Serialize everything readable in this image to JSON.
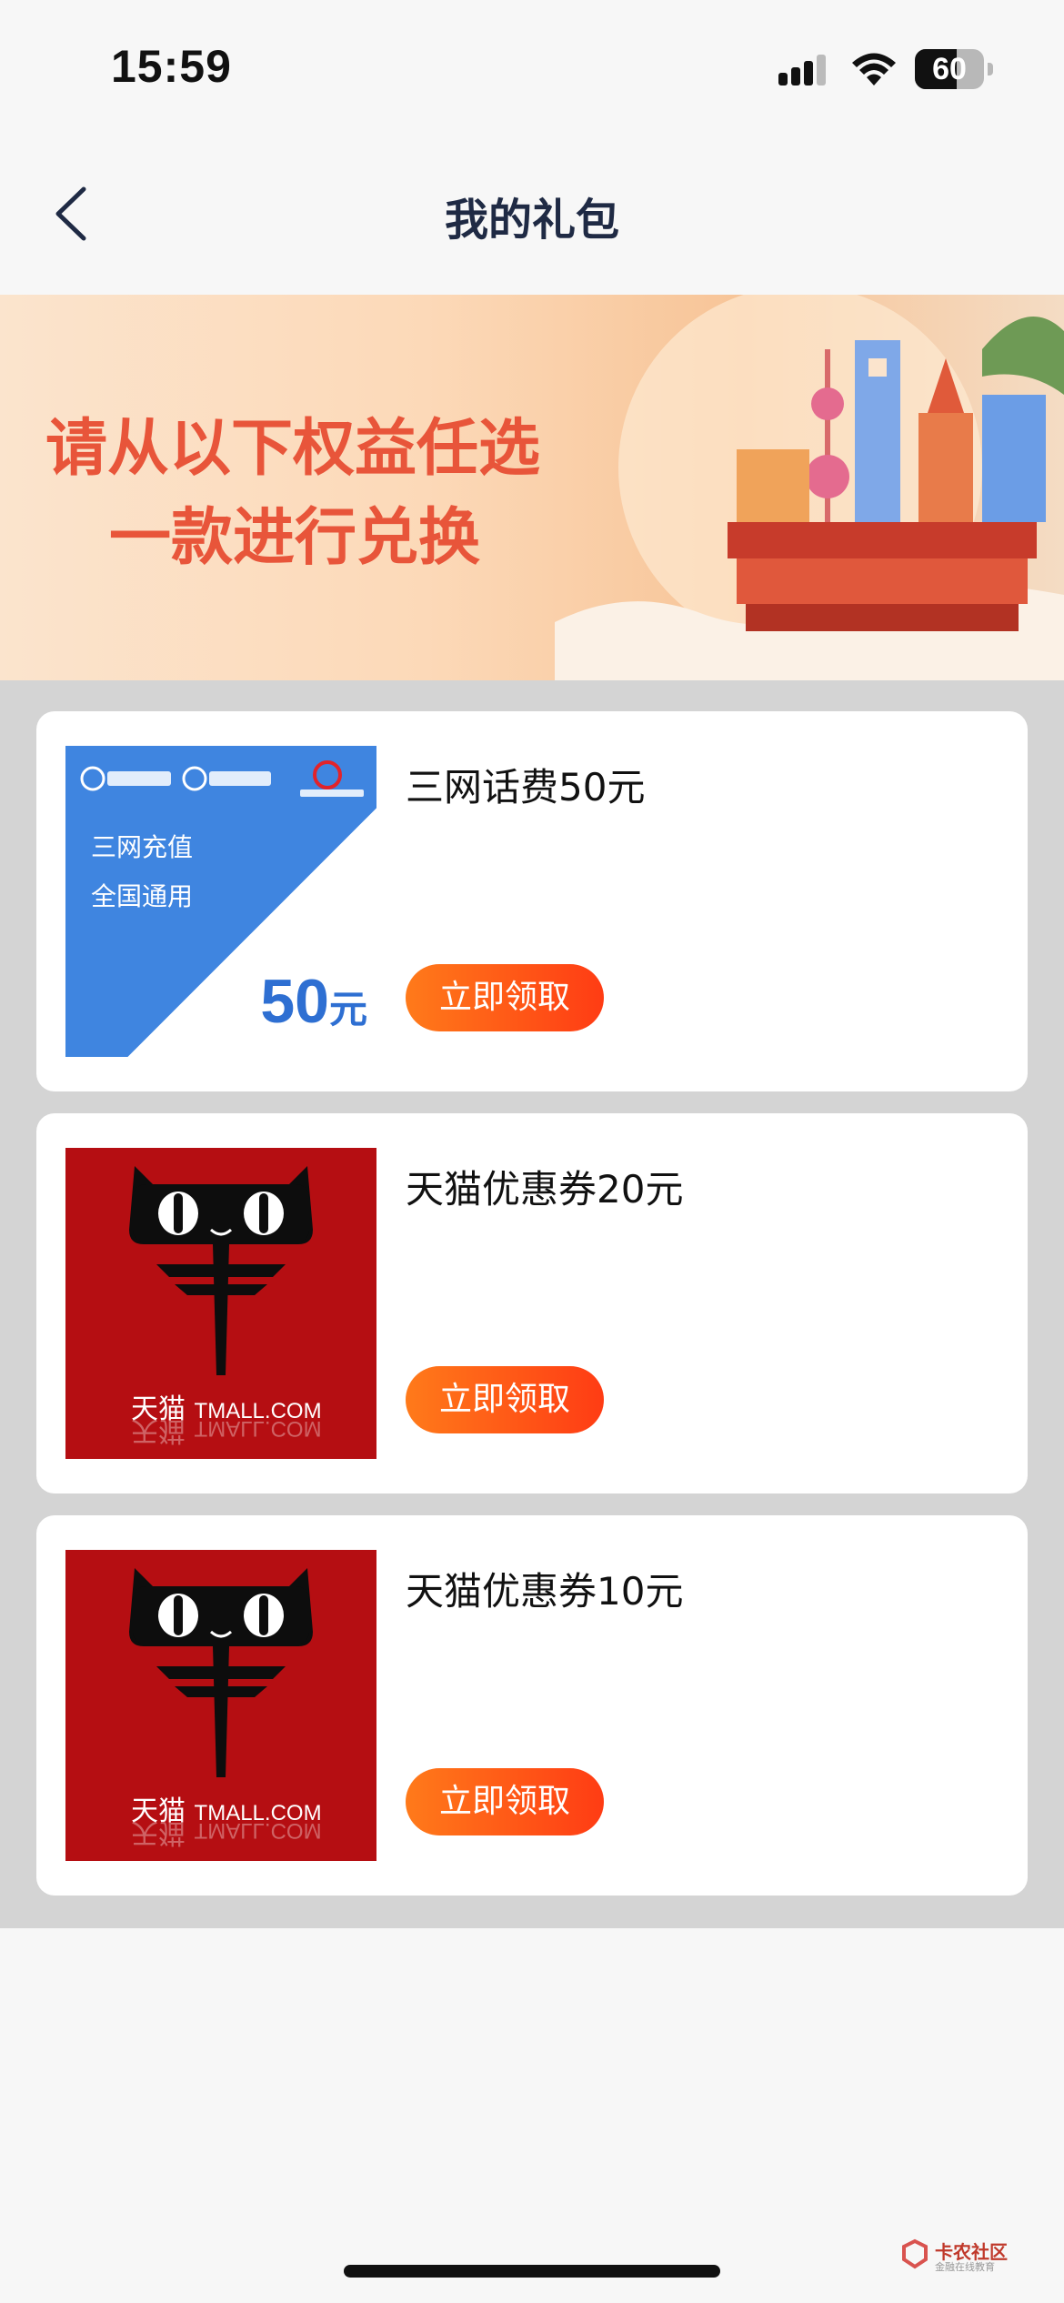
{
  "status_bar": {
    "time": "15:59",
    "battery": "60",
    "battery_level": 0.6
  },
  "nav": {
    "title": "我的礼包"
  },
  "banner": {
    "line1": "请从以下权益任选",
    "line2": "一款进行兑换"
  },
  "cards": [
    {
      "title": "三网话费50元",
      "button": "立即领取",
      "thumb": {
        "type": "telecom",
        "line1": "三网充值",
        "line2": "全国通用",
        "amount": "50",
        "unit": "元",
        "logos": [
          "中国电信 CHINA TELECOM",
          "中国移动 China Mobile",
          "China unicom中国联通"
        ]
      }
    },
    {
      "title": "天猫优惠券20元",
      "button": "立即领取",
      "thumb": {
        "type": "tmall",
        "brand_cn": "天猫",
        "brand_en": "TMALL.COM"
      }
    },
    {
      "title": "天猫优惠券10元",
      "button": "立即领取",
      "thumb": {
        "type": "tmall",
        "brand_cn": "天猫",
        "brand_en": "TMALL.COM"
      }
    }
  ],
  "watermark": {
    "name": "卡农社区",
    "sub": "金融在线教育"
  },
  "colors": {
    "accent": "#ff5a1a",
    "nav_title": "#1f2a44",
    "banner_text": "#e8553a",
    "tmall_red": "#b50e12",
    "telecom_blue": "#3f85e0"
  }
}
